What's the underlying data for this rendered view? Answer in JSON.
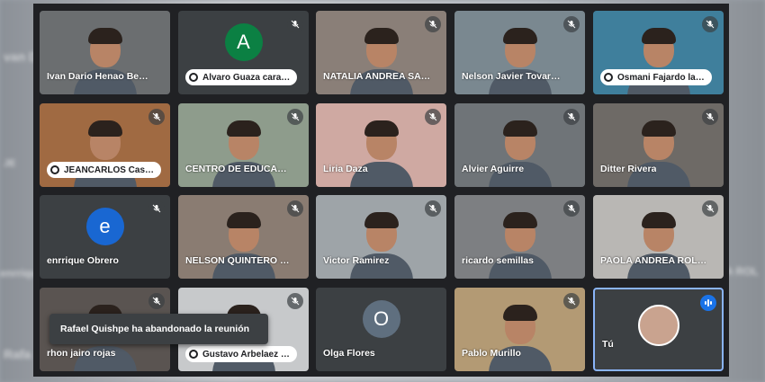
{
  "meeting": {
    "toast": "Rafael Quishpe ha abandonado la reunión",
    "tiles": [
      {
        "name": "Ivan Dario Henao Be…",
        "type": "video",
        "bg": "#6b6e70",
        "muted": false
      },
      {
        "name": "Alvaro Guaza cara…",
        "type": "avatar",
        "letter": "A",
        "avatar_color": "#0b8043",
        "pinned_label": true,
        "muted": true
      },
      {
        "name": "NATALIA ANDREA SA…",
        "type": "video",
        "bg": "#8a7f78",
        "muted": true
      },
      {
        "name": "Nelson Javier Tovar…",
        "type": "video",
        "bg": "#7a8890",
        "muted": true
      },
      {
        "name": "Osmani Fajardo la…",
        "type": "video",
        "bg": "#3f7f9c",
        "pinned_label": true,
        "muted": true
      },
      {
        "name": "JEANCARLOS Cas…",
        "type": "video",
        "bg": "#a06a42",
        "pinned_label": true,
        "muted": true
      },
      {
        "name": "CENTRO DE EDUCA…",
        "type": "video",
        "bg": "#8e9c8c",
        "muted": true
      },
      {
        "name": "Liria Daza",
        "type": "video",
        "bg": "#cfa9a2",
        "muted": true
      },
      {
        "name": "Alvier Aguirre",
        "type": "video",
        "bg": "#6f7478",
        "muted": true
      },
      {
        "name": "Ditter Rivera",
        "type": "video",
        "bg": "#6e6a66",
        "muted": true
      },
      {
        "name": "enrrique Obrero",
        "type": "avatar",
        "letter": "e",
        "avatar_color": "#1967d2",
        "muted": true
      },
      {
        "name": "NELSON QUINTERO …",
        "type": "video",
        "bg": "#8a7c72",
        "muted": true
      },
      {
        "name": "Victor Ramirez",
        "type": "video",
        "bg": "#9ea4a8",
        "muted": true
      },
      {
        "name": "ricardo semillas",
        "type": "video",
        "bg": "#7d7f82",
        "muted": true
      },
      {
        "name": "PAOLA ANDREA ROL…",
        "type": "video",
        "bg": "#b9b7b4",
        "muted": true
      },
      {
        "name": "rhon jairo rojas",
        "type": "video",
        "bg": "#5a5451",
        "muted": true
      },
      {
        "name": "Gustavo Arbelaez …",
        "type": "video",
        "bg": "#c7c9cb",
        "pinned_label": true,
        "muted": true
      },
      {
        "name": "Olga Flores",
        "type": "avatar",
        "letter": "O",
        "avatar_color": "#5f6f7f",
        "muted": false
      },
      {
        "name": "Pablo Murillo",
        "type": "video",
        "bg": "#b39a74",
        "muted": true
      },
      {
        "name": "Tú",
        "type": "self",
        "muted": false,
        "speaking": true
      }
    ]
  },
  "background_ghost": [
    "van D",
    "JE",
    "enrrique",
    "Rafa",
    "A ROL"
  ]
}
